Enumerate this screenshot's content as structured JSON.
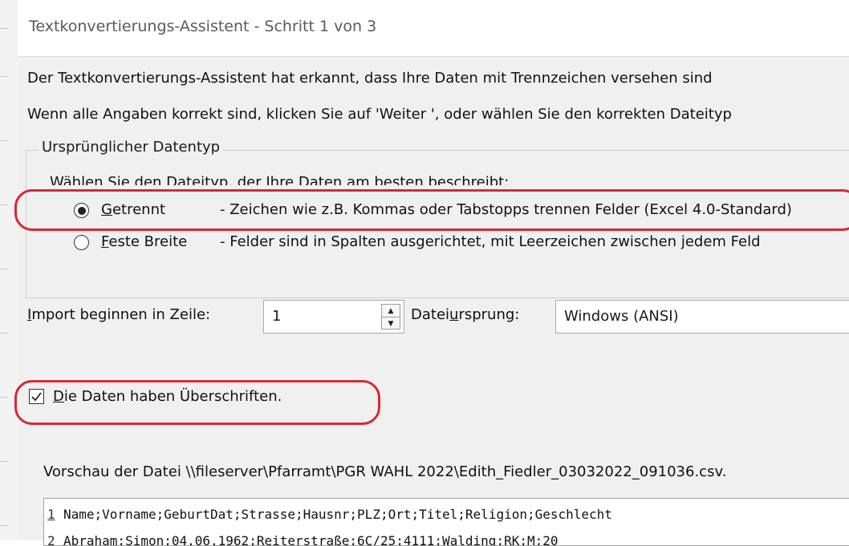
{
  "window": {
    "title": "Textkonvertierungs-Assistent - Schritt 1 von 3"
  },
  "intro": {
    "line1": "Der Textkonvertierungs-Assistent hat erkannt, dass Ihre Daten mit Trennzeichen versehen sind",
    "line2": "Wenn alle Angaben korrekt sind, klicken Sie auf 'Weiter ', oder wählen Sie den korrekten Dateityp"
  },
  "datatype_group": {
    "legend": "Ursprünglicher Datentyp",
    "prompt": "Wählen Sie den Dateityp, der Ihre Daten am besten beschreibt:",
    "options": [
      {
        "mnemonic": "G",
        "label_rest": "etrennt",
        "description": "- Zeichen wie z.B. Kommas oder Tabstopps trennen Felder (Excel 4.0-Standard)",
        "selected": true
      },
      {
        "mnemonic": "F",
        "label_rest": "este Breite",
        "description": "- Felder sind in Spalten ausgerichtet, mit Leerzeichen zwischen jedem Feld",
        "selected": false
      }
    ]
  },
  "import_row": {
    "start_label_mnemonic": "I",
    "start_label_rest": "mport beginnen in Zeile:",
    "start_value": "1",
    "origin_label_pre": "Datei",
    "origin_label_mnemonic": "u",
    "origin_label_post": "rsprung:",
    "origin_value": "Windows (ANSI)"
  },
  "headers_checkbox": {
    "mnemonic": "D",
    "label_rest": "ie Daten haben Überschriften.",
    "checked": true
  },
  "preview": {
    "label": "Vorschau der Datei \\\\fileserver\\Pfarramt\\PGR WAHL 2022\\Edith_Fiedler_03032022_091036.csv.",
    "rows": [
      {
        "num": "1",
        "text": "Name;Vorname;GeburtDat;Strasse;Hausnr;PLZ;Ort;Titel;Religion;Geschlecht"
      },
      {
        "num": "2",
        "text": "Abraham;Simon;04.06.1962;Reiterstraße;6C/25;4111;Walding;RK;M;20"
      }
    ]
  },
  "colors": {
    "annotation": "#d62a33",
    "dialog_background": "#f0f0f0"
  }
}
